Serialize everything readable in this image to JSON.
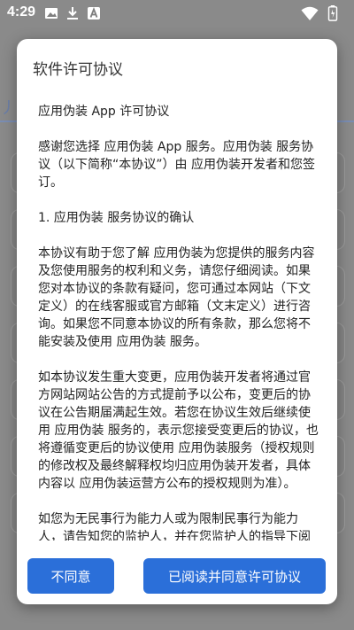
{
  "status_bar": {
    "time": "4:29",
    "icons": [
      "image-icon",
      "download-icon",
      "app-a-icon",
      "wifi-icon",
      "battery-icon"
    ]
  },
  "dialog": {
    "title": "软件许可协议",
    "paragraphs": [
      "应用伪装 App 许可协议",
      "感谢您选择 应用伪装 App 服务。应用伪装 服务协议（以下简称“本协议”）由 应用伪装开发者和您签订。",
      "1. 应用伪装 服务协议的确认",
      "本协议有助于您了解 应用伪装为您提供的服务内容及您使用服务的权利和义务，请您仔细阅读。如果您对本协议的条款有疑问，您可通过本网站（下文定义）的在线客服或官方邮箱（文末定义）进行咨询。如果您不同意本协议的所有条款，那么您将不能安装及使用 应用伪装 服务。",
      "如本协议发生重大变更，应用伪装开发者将通过官方网站网站公告的方式提前予以公布，变更后的协议在公告期届满起生效。若您在协议生效后继续使用 应用伪装 服务的，表示您接受变更后的协议，也将遵循变更后的协议使用 应用伪装服务（授权规则的修改权及最终解释权均归应用伪装开发者，具体内容以 应用伪装运营方公布的授权规则为准）。",
      "如您为无民事行为能力人或为限制民事行为能力人，请告知您的监护人，并在您监护人的指导下阅读本协议和使用 应用伪装 服务。若您是中国大陆以外的用户，您还需同时遵守您所属国家或"
    ],
    "disagree_label": "不同意",
    "agree_label": "已阅读并同意许可协议"
  },
  "colors": {
    "accent": "#2b6fd9",
    "scrim": "#8a8a8a"
  }
}
